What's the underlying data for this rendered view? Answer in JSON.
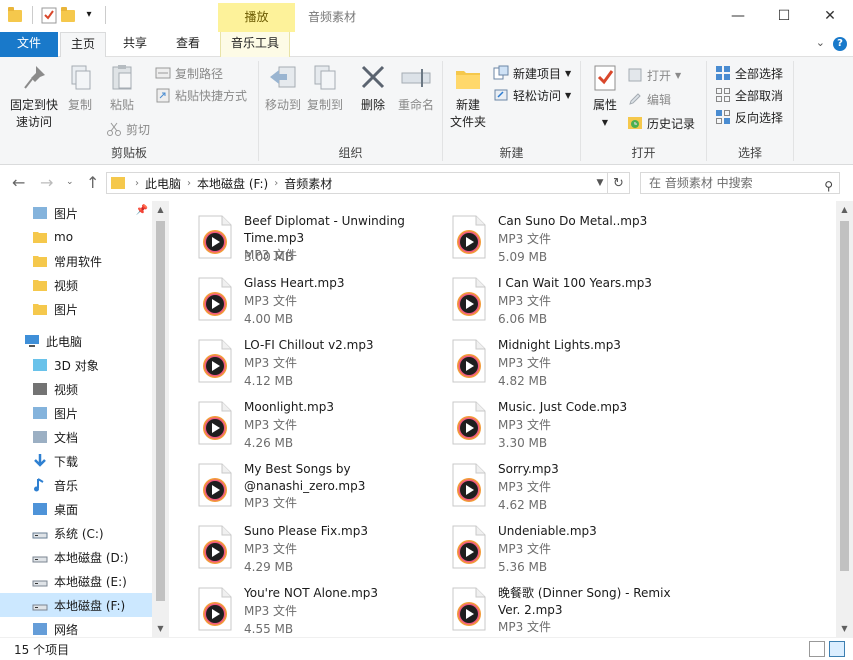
{
  "window": {
    "title": "音频素材",
    "contextual_tab_group": "播放",
    "minimize_glyph": "—",
    "maximize_glyph": "☐",
    "close_glyph": "✕",
    "qat_dropdown_glyph": "▾"
  },
  "tabs": {
    "file": "文件",
    "home": "主页",
    "share": "共享",
    "view": "查看",
    "music_tools": "音乐工具",
    "help": "?",
    "collapse": "⌄"
  },
  "ribbon": {
    "clipboard": {
      "label": "剪贴板",
      "pin": "固定到快速访问",
      "pin_line1": "固定到快",
      "pin_line2": "速访问",
      "copy": "复制",
      "paste": "粘贴",
      "copy_path": "复制路径",
      "paste_shortcut": "粘贴快捷方式",
      "cut": "剪切"
    },
    "organize": {
      "label": "组织",
      "move_to": "移动到",
      "copy_to": "复制到",
      "delete": "删除",
      "rename": "重命名"
    },
    "new": {
      "label": "新建",
      "new_folder_line1": "新建",
      "new_folder_line2": "文件夹",
      "new_item": "新建项目",
      "easy_access": "轻松访问"
    },
    "open": {
      "label": "打开",
      "properties": "属性",
      "open": "打开",
      "edit": "编辑",
      "history": "历史记录"
    },
    "select": {
      "label": "选择",
      "select_all": "全部选择",
      "select_none": "全部取消",
      "invert": "反向选择"
    }
  },
  "address": {
    "crumbs": [
      "此电脑",
      "本地磁盘 (F:)",
      "音频素材"
    ],
    "search_placeholder": "在 音频素材 中搜索"
  },
  "nav": {
    "quick": [
      {
        "label": "图片",
        "icon": "pictures-icon",
        "pinned": true
      },
      {
        "label": "mo",
        "icon": "folder-icon"
      },
      {
        "label": "常用软件",
        "icon": "folder-icon"
      },
      {
        "label": "视频",
        "icon": "folder-icon"
      },
      {
        "label": "图片",
        "icon": "folder-icon"
      }
    ],
    "this_pc": "此电脑",
    "pc_items": [
      {
        "label": "3D 对象",
        "icon": "3d-objects-icon"
      },
      {
        "label": "视频",
        "icon": "videos-icon"
      },
      {
        "label": "图片",
        "icon": "pictures-icon"
      },
      {
        "label": "文档",
        "icon": "documents-icon"
      },
      {
        "label": "下载",
        "icon": "downloads-icon"
      },
      {
        "label": "音乐",
        "icon": "music-icon"
      },
      {
        "label": "桌面",
        "icon": "desktop-icon"
      },
      {
        "label": "系统 (C:)",
        "icon": "system-drive-icon"
      },
      {
        "label": "本地磁盘 (D:)",
        "icon": "drive-icon"
      },
      {
        "label": "本地磁盘 (E:)",
        "icon": "drive-icon"
      },
      {
        "label": "本地磁盘 (F:)",
        "icon": "drive-icon",
        "selected": true
      },
      {
        "label": "网络",
        "icon": "network-icon"
      }
    ]
  },
  "files": [
    {
      "name": "Beef Diplomat - Unwinding Time.mp3",
      "type": "MP3 文件",
      "size": "3.00 MB"
    },
    {
      "name": "Can Suno Do Metal..mp3",
      "type": "MP3 文件",
      "size": "5.09 MB"
    },
    {
      "name": "Glass Heart.mp3",
      "type": "MP3 文件",
      "size": "4.00 MB"
    },
    {
      "name": "I Can Wait 100 Years.mp3",
      "type": "MP3 文件",
      "size": "6.06 MB"
    },
    {
      "name": "LO-FI Chillout v2.mp3",
      "type": "MP3 文件",
      "size": "4.12 MB"
    },
    {
      "name": "Midnight Lights.mp3",
      "type": "MP3 文件",
      "size": "4.82 MB"
    },
    {
      "name": "Moonlight.mp3",
      "type": "MP3 文件",
      "size": "4.26 MB"
    },
    {
      "name": "Music. Just Code.mp3",
      "type": "MP3 文件",
      "size": "3.30 MB"
    },
    {
      "name": "My Best Songs by @nanashi_zero.mp3",
      "type": "MP3 文件",
      "size": ""
    },
    {
      "name": "Sorry.mp3",
      "type": "MP3 文件",
      "size": "4.62 MB"
    },
    {
      "name": "Suno Please Fix.mp3",
      "type": "MP3 文件",
      "size": "4.29 MB"
    },
    {
      "name": "Undeniable.mp3",
      "type": "MP3 文件",
      "size": "5.36 MB"
    },
    {
      "name": "You're NOT Alone.mp3",
      "type": "MP3 文件",
      "size": "4.55 MB"
    },
    {
      "name": "晚餐歌 (Dinner Song) - Remix Ver. 2.mp3",
      "type": "MP3 文件",
      "size": ""
    }
  ],
  "status": {
    "count": "15 个项目"
  },
  "colors": {
    "accent": "#1979ca",
    "contextual_tab": "#fdf29a",
    "selection": "#cce8ff",
    "folder": "#f5c84c"
  }
}
